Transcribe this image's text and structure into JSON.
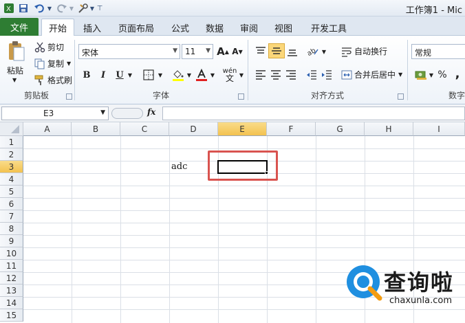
{
  "window": {
    "title": "工作簿1 - Mic"
  },
  "tabs": {
    "file": "文件",
    "items": [
      "开始",
      "插入",
      "页面布局",
      "公式",
      "数据",
      "审阅",
      "视图",
      "开发工具"
    ]
  },
  "clipboard": {
    "paste": "粘贴",
    "cut": "剪切",
    "copy": "复制",
    "format_painter": "格式刷",
    "label": "剪贴板"
  },
  "font": {
    "name": "宋体",
    "size": "11",
    "grow": "A",
    "shrink": "A",
    "bold": "B",
    "italic": "I",
    "underline": "U",
    "phonetic": "wén",
    "label": "字体"
  },
  "alignment": {
    "wrap_text": "自动换行",
    "merge_center": "合并后居中",
    "label": "对齐方式"
  },
  "number": {
    "format": "常规",
    "percent": "%",
    "comma": ",",
    "label": "数字"
  },
  "formula_bar": {
    "name_box": "E3",
    "fx": "fx",
    "formula": ""
  },
  "sheet": {
    "columns": [
      "A",
      "B",
      "C",
      "D",
      "E",
      "F",
      "G",
      "H",
      "I"
    ],
    "rows": [
      "1",
      "2",
      "3",
      "4",
      "5",
      "6",
      "7",
      "8",
      "9",
      "10",
      "11",
      "12",
      "13",
      "14",
      "15"
    ],
    "selected_column": "E",
    "selected_row": "3",
    "cell_D3": "adc",
    "active_cell": "E3"
  },
  "watermark": {
    "name": "查询啦",
    "url": "chaxunla.com"
  },
  "colors": {
    "file_tab": "#2e7d33",
    "highlight_header": "#f3c24f",
    "annotation_box": "#d9534f",
    "watermark_blue": "#1f8fe0"
  }
}
